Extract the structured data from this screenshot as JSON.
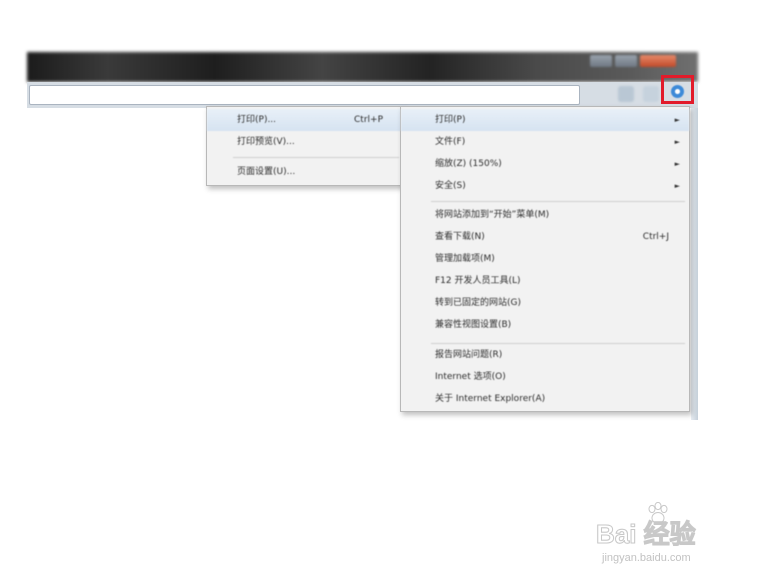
{
  "browser": {
    "window_buttons": [
      "minimize",
      "maximize",
      "close"
    ],
    "toolbar": {
      "icons": [
        "home-icon",
        "favorites-icon",
        "gear-icon"
      ],
      "highlight_color": "#e21b2a"
    }
  },
  "tools_menu": {
    "items": [
      {
        "label": "打印(P)",
        "shortcut": "",
        "submenu": true
      },
      {
        "label": "文件(F)",
        "shortcut": "",
        "submenu": true
      },
      {
        "label": "缩放(Z) (150%)",
        "shortcut": "",
        "submenu": true
      },
      {
        "label": "安全(S)",
        "shortcut": "",
        "submenu": true
      },
      {
        "label": "将网站添加到“开始”菜单(M)",
        "shortcut": ""
      },
      {
        "label": "查看下载(N)",
        "shortcut": "Ctrl+J"
      },
      {
        "label": "管理加载项(M)",
        "shortcut": ""
      },
      {
        "label": "F12 开发人员工具(L)",
        "shortcut": ""
      },
      {
        "label": "转到已固定的网站(G)",
        "shortcut": ""
      },
      {
        "label": "兼容性视图设置(B)",
        "shortcut": ""
      },
      {
        "label": "报告网站问题(R)",
        "shortcut": ""
      },
      {
        "label": "Internet 选项(O)",
        "shortcut": ""
      },
      {
        "label": "关于 Internet Explorer(A)",
        "shortcut": ""
      }
    ],
    "arrow": "►"
  },
  "print_submenu": {
    "items": [
      {
        "label": "打印(P)...",
        "shortcut": "Ctrl+P"
      },
      {
        "label": "打印预览(V)...",
        "shortcut": ""
      },
      {
        "label": "页面设置(U)...",
        "shortcut": ""
      }
    ]
  },
  "watermark": {
    "logo": "Bai 经验",
    "url": "jingyan.baidu.com"
  }
}
